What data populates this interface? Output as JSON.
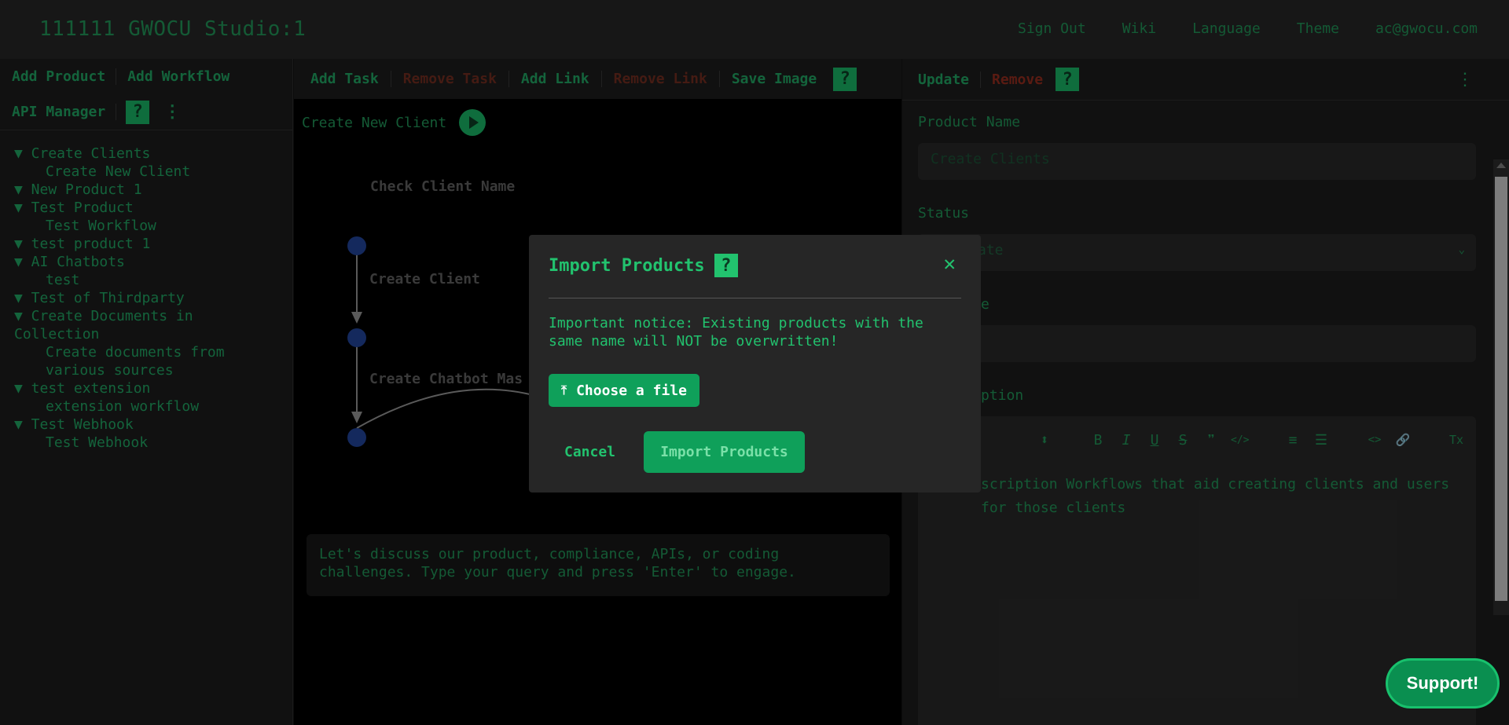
{
  "header": {
    "brand": "111111 GWOCU Studio:1",
    "nav": [
      "Sign Out",
      "Wiki",
      "Language",
      "Theme",
      "ac@gwocu.com"
    ]
  },
  "left": {
    "toolbar": {
      "add_product": "Add Product",
      "add_workflow": "Add Workflow",
      "api_manager": "API Manager",
      "help": "?",
      "more": "⋮"
    },
    "tree": [
      {
        "label": "▼ Create Clients",
        "level": 0
      },
      {
        "label": "Create New Client",
        "level": 1
      },
      {
        "label": "▼ New Product 1",
        "level": 0
      },
      {
        "label": "▼ Test Product",
        "level": 0
      },
      {
        "label": "Test Workflow",
        "level": 1
      },
      {
        "label": "▼ test product 1",
        "level": 0
      },
      {
        "label": "▼ AI Chatbots",
        "level": 0
      },
      {
        "label": "test",
        "level": 1
      },
      {
        "label": "▼ Test of Thirdparty",
        "level": 0
      },
      {
        "label": "▼ Create Documents in Collection",
        "level": 0
      },
      {
        "label": "Create documents from various sources",
        "level": 1
      },
      {
        "label": "▼ test extension",
        "level": 0
      },
      {
        "label": "extension workflow",
        "level": 1
      },
      {
        "label": "▼ Test Webhook",
        "level": 0
      },
      {
        "label": "Test Webhook",
        "level": 1
      }
    ]
  },
  "center": {
    "toolbar": {
      "add_task": "Add Task",
      "remove_task": "Remove Task",
      "add_link": "Add Link",
      "remove_link": "Remove Link",
      "save_image": "Save Image",
      "help": "?"
    },
    "workflow_name": "Create New Client",
    "nodes": [
      "Check Client Name",
      "Create Client",
      "Create Chatbot Mas"
    ],
    "chat_placeholder": "Let's discuss our product, compliance, APIs, or coding challenges. Type your query and press 'Enter' to engage."
  },
  "right": {
    "toolbar": {
      "update": "Update",
      "remove": "Remove",
      "help": "?",
      "more": "⋮"
    },
    "product_name_label": "Product Name",
    "product_name_value": "Create Clients",
    "status_label": "Status",
    "status_value": "ate",
    "third_label": "e",
    "description_label": "ption",
    "description_text": "scription Workflows that aid creating clients and users for those clients",
    "editor_tools": [
      "⬍",
      "B",
      "I",
      "U",
      "S",
      "❞",
      "</>",
      "≡",
      "☰",
      "<>",
      "🔗",
      "Tx"
    ]
  },
  "modal": {
    "title": "Import Products",
    "help": "?",
    "close": "✕",
    "notice": "Important notice: Existing products with the same name will NOT be overwritten!",
    "choose_file": "Choose a file",
    "choose_icon": "⤒",
    "cancel": "Cancel",
    "import": "Import Products"
  },
  "support": "Support!"
}
